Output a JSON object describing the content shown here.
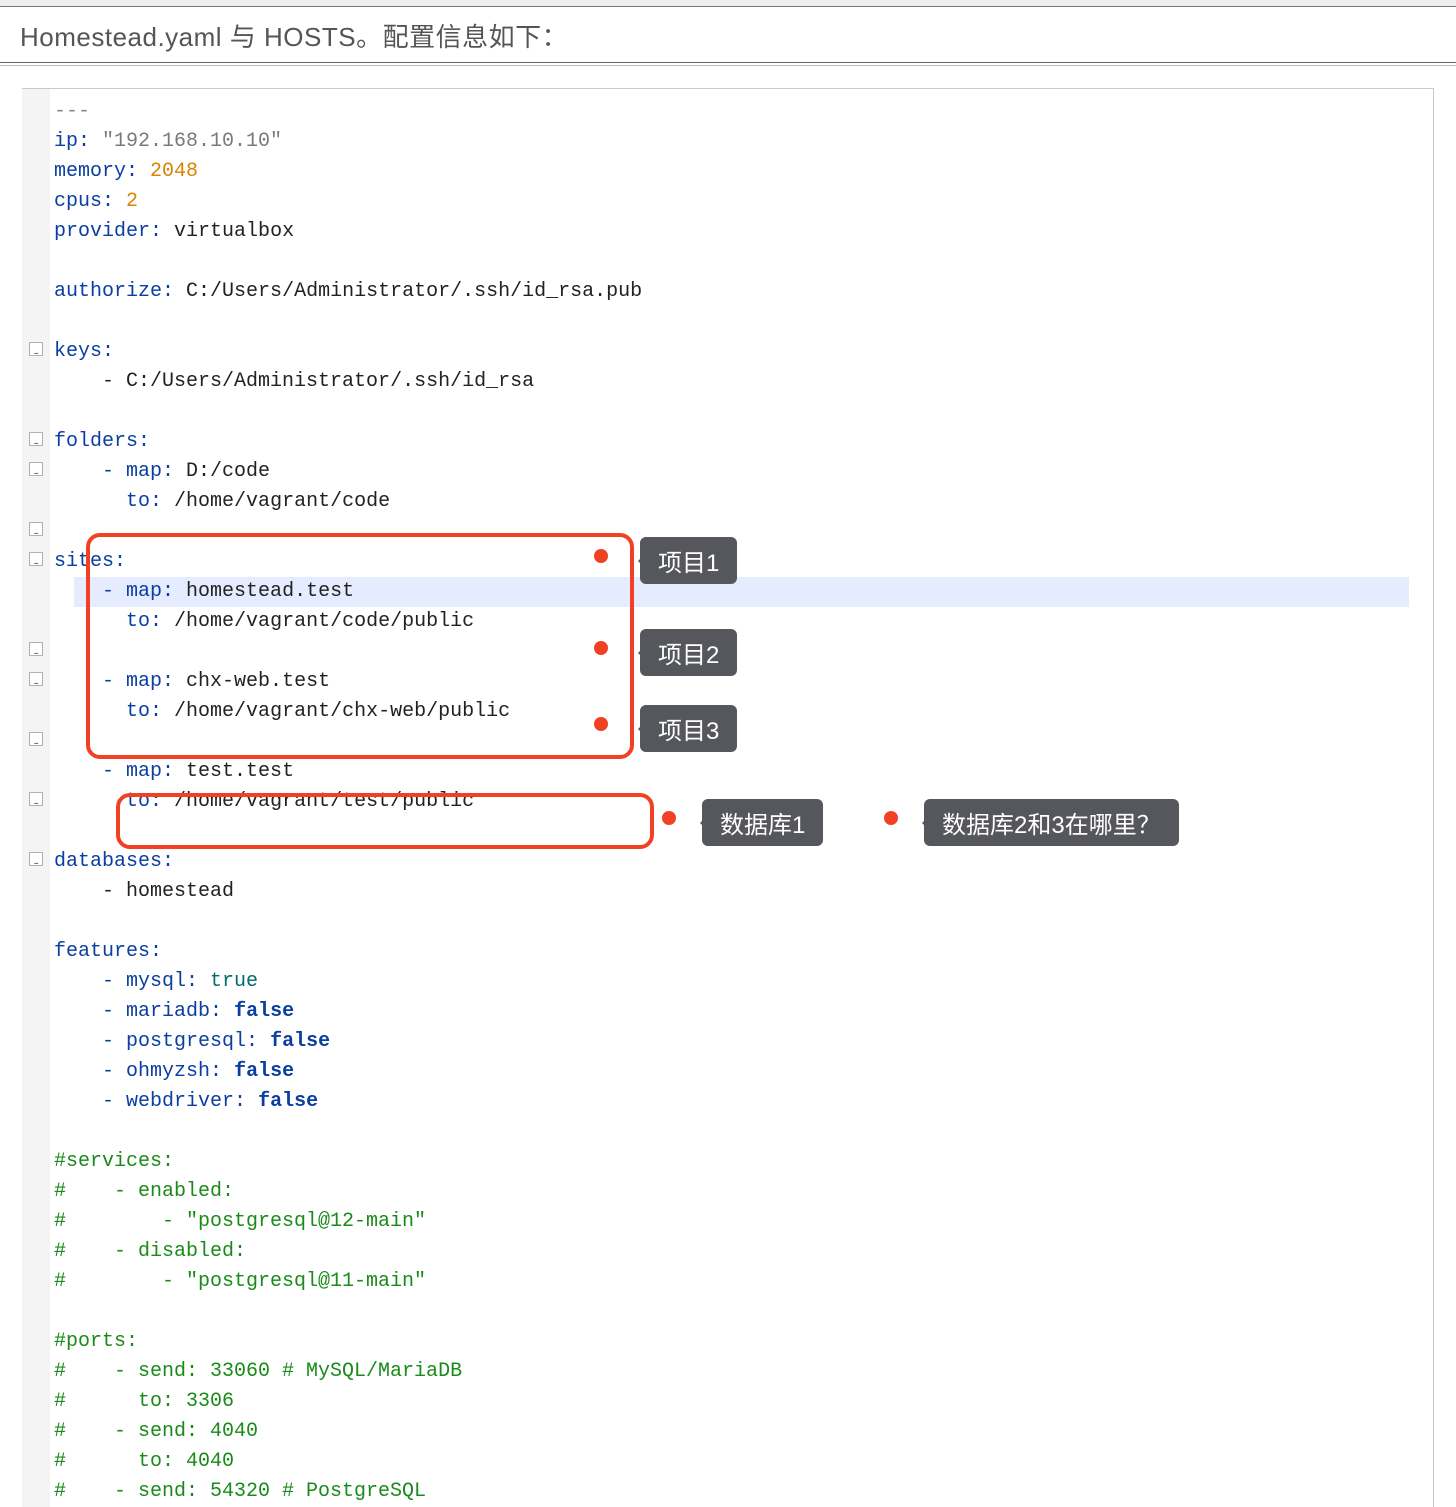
{
  "header": "Homestead.yaml 与 HOSTS。配置信息如下：",
  "code": {
    "dash3": "---",
    "ip_k": "ip:",
    "ip_v": "\"192.168.10.10\"",
    "mem_k": "memory:",
    "mem_v": "2048",
    "cpu_k": "cpus:",
    "cpu_v": "2",
    "prov_k": "provider:",
    "prov_v": "virtualbox",
    "auth_k": "authorize:",
    "auth_v": "C:/Users/Administrator/.ssh/id_rsa.pub",
    "keys_k": "keys:",
    "keys_item": "- C:/Users/Administrator/.ssh/id_rsa",
    "fold_k": "folders:",
    "fold_map_k": "- map:",
    "fold_map_v": "D:/code",
    "fold_to_k": "to:",
    "fold_to_v": "/home/vagrant/code",
    "sites_k": "sites:",
    "s1_map_k": "- map:",
    "s1_map_v": "homestead.test",
    "s1_to_k": "to:",
    "s1_to_v": "/home/vagrant/code/public",
    "s2_map_k": "- map:",
    "s2_map_v": "chx-web.test",
    "s2_to_k": "to:",
    "s2_to_v": "/home/vagrant/chx-web/public",
    "s3_map_k": "- map:",
    "s3_map_v": "test.test",
    "s3_to_k": "to:",
    "s3_to_v": "/home/vagrant/test/public",
    "db_k": "databases:",
    "db_item": "- homestead",
    "feat_k": "features:",
    "f1_k": "- mysql:",
    "f1_v": "true",
    "f2_k": "- mariadb:",
    "f2_v": "false",
    "f3_k": "- postgresql:",
    "f3_v": "false",
    "f4_k": "- ohmyzsh:",
    "f4_v": "false",
    "f5_k": "- webdriver:",
    "f5_v": "false",
    "c_services": "#services:",
    "c_enabled": "#    - enabled:",
    "c_pg12": "#        - \"postgresql@12-main\"",
    "c_disabled": "#    - disabled:",
    "c_pg11": "#        - \"postgresql@11-main\"",
    "c_ports": "#ports:",
    "c_p1": "#    - send: 33060 # MySQL/MariaDB",
    "c_p2": "#      to: 3306",
    "c_p3": "#    - send: 4040",
    "c_p4": "#      to: 4040",
    "c_p5": "#    - send: 54320 # PostgreSQL"
  },
  "annotations": {
    "tag1": "项目1",
    "tag2": "项目2",
    "tag3": "项目3",
    "db1": "数据库1",
    "dbq": "数据库2和3在哪里？"
  }
}
